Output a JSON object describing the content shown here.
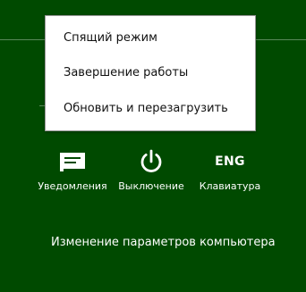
{
  "power_menu": {
    "items": [
      {
        "label": "Спящий режим"
      },
      {
        "label": "Завершение работы"
      },
      {
        "label": "Обновить и перезагрузить"
      }
    ]
  },
  "charms": {
    "notifications": {
      "icon": "notifications-icon",
      "label": "Уведомления"
    },
    "power": {
      "icon": "power-icon",
      "label": "Выключение"
    },
    "keyboard": {
      "icon": "keyboard-language-icon",
      "indicator": "ENG",
      "label": "Клавиатура"
    }
  },
  "settings_link": "Изменение параметров компьютера",
  "colors": {
    "background": "#004a00",
    "menu_background": "#ffffff",
    "menu_text": "#111111",
    "foreground": "#ffffff"
  }
}
